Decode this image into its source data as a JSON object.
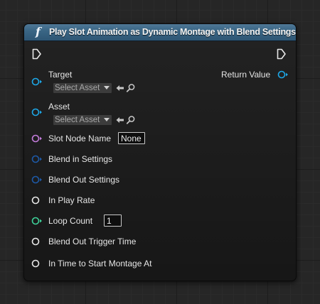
{
  "node": {
    "title": "Play Slot Animation as Dynamic Montage with Blend Settings",
    "header_color": "#3a6685",
    "icon": "function-icon"
  },
  "inputs": [
    {
      "label": "Target",
      "pin_color": "#1da8e8",
      "select_label": "Select Asset"
    },
    {
      "label": "Asset",
      "pin_color": "#1da8e8",
      "select_label": "Select Asset"
    },
    {
      "label": "Slot Node Name",
      "pin_color": "#c57ddd",
      "value": "None"
    },
    {
      "label": "Blend in Settings",
      "pin_color": "#1e5aa8"
    },
    {
      "label": "Blend Out Settings",
      "pin_color": "#1e5aa8"
    },
    {
      "label": "In Play Rate",
      "pin_color": "#e8e8e8"
    },
    {
      "label": "Loop Count",
      "pin_color": "#3ed29a",
      "value": "1"
    },
    {
      "label": "Blend Out Trigger Time",
      "pin_color": "#e8e8e8"
    },
    {
      "label": "In Time to Start Montage At",
      "pin_color": "#e8e8e8"
    }
  ],
  "outputs": [
    {
      "label": "Return Value",
      "pin_color": "#1da8e8"
    }
  ]
}
